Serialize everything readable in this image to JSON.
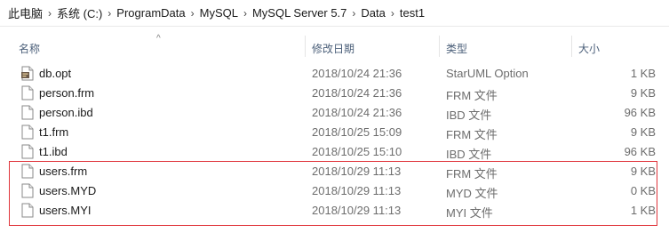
{
  "breadcrumb": [
    "此电脑",
    "系统 (C:)",
    "ProgramData",
    "MySQL",
    "MySQL Server 5.7",
    "Data",
    "test1"
  ],
  "columns": {
    "name": "名称",
    "date": "修改日期",
    "type": "类型",
    "size": "大小"
  },
  "sort_indicator": "^",
  "files": [
    {
      "name": "db.opt",
      "date": "2018/10/24 21:36",
      "type": "StarUML Option",
      "size": "1 KB",
      "icon": "staruml-file-icon"
    },
    {
      "name": "person.frm",
      "date": "2018/10/24 21:36",
      "type": "FRM 文件",
      "size": "9 KB",
      "icon": "file-icon"
    },
    {
      "name": "person.ibd",
      "date": "2018/10/24 21:36",
      "type": "IBD 文件",
      "size": "96 KB",
      "icon": "file-icon"
    },
    {
      "name": "t1.frm",
      "date": "2018/10/25 15:09",
      "type": "FRM 文件",
      "size": "9 KB",
      "icon": "file-icon"
    },
    {
      "name": "t1.ibd",
      "date": "2018/10/25 15:10",
      "type": "IBD 文件",
      "size": "96 KB",
      "icon": "file-icon"
    },
    {
      "name": "users.frm",
      "date": "2018/10/29 11:13",
      "type": "FRM 文件",
      "size": "9 KB",
      "icon": "file-icon"
    },
    {
      "name": "users.MYD",
      "date": "2018/10/29 11:13",
      "type": "MYD 文件",
      "size": "0 KB",
      "icon": "file-icon"
    },
    {
      "name": "users.MYI",
      "date": "2018/10/29 11:13",
      "type": "MYI 文件",
      "size": "1 KB",
      "icon": "file-icon"
    }
  ],
  "colors": {
    "highlight_border": "#e0353b",
    "header_text": "#4c607a",
    "secondary_text": "#6d6d6d"
  }
}
